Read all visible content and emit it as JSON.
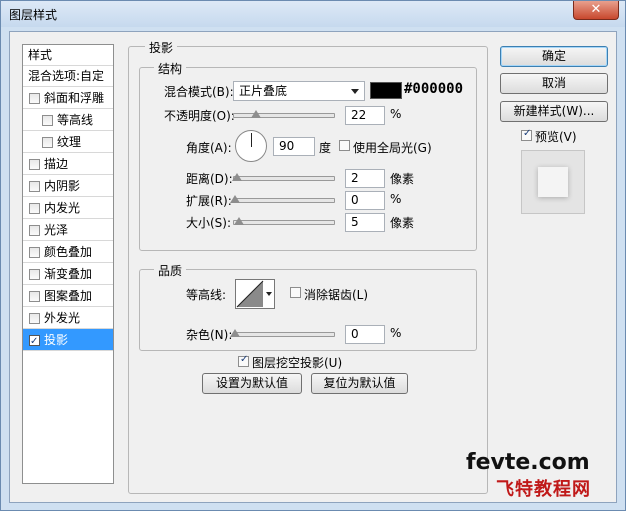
{
  "window": {
    "title": "图层样式",
    "close_glyph": "✕"
  },
  "sidebar": {
    "header": "样式",
    "blend_options": "混合选项:自定",
    "items": [
      {
        "label": "斜面和浮雕",
        "checked": false,
        "indent": false
      },
      {
        "label": "等高线",
        "checked": false,
        "indent": true
      },
      {
        "label": "纹理",
        "checked": false,
        "indent": true
      },
      {
        "label": "描边",
        "checked": false,
        "indent": false
      },
      {
        "label": "内阴影",
        "checked": false,
        "indent": false
      },
      {
        "label": "内发光",
        "checked": false,
        "indent": false
      },
      {
        "label": "光泽",
        "checked": false,
        "indent": false
      },
      {
        "label": "颜色叠加",
        "checked": false,
        "indent": false
      },
      {
        "label": "渐变叠加",
        "checked": false,
        "indent": false
      },
      {
        "label": "图案叠加",
        "checked": false,
        "indent": false
      },
      {
        "label": "外发光",
        "checked": false,
        "indent": false
      },
      {
        "label": "投影",
        "checked": true,
        "indent": false,
        "selected": true
      }
    ]
  },
  "panel": {
    "title": "投影",
    "structure": {
      "title": "结构",
      "blend_mode_label": "混合模式(B):",
      "blend_mode_value": "正片叠底",
      "color_hex": "#000000",
      "color_text": "#000000",
      "opacity_label": "不透明度(O):",
      "opacity_value": "22",
      "opacity_unit": "%",
      "opacity_fraction": 0.22,
      "angle_label": "角度(A):",
      "angle_value": "90",
      "angle_unit": "度",
      "global_light_label": "使用全局光(G)",
      "global_light_checked": false,
      "distance_label": "距离(D):",
      "distance_value": "2",
      "distance_unit": "像素",
      "spread_label": "扩展(R):",
      "spread_value": "0",
      "spread_unit": "%",
      "size_label": "大小(S):",
      "size_value": "5",
      "size_unit": "像素"
    },
    "quality": {
      "title": "品质",
      "contour_label": "等高线:",
      "antialias_label": "消除锯齿(L)",
      "antialias_checked": false,
      "noise_label": "杂色(N):",
      "noise_value": "0",
      "noise_unit": "%"
    },
    "knockout_label": "图层挖空投影(U)",
    "knockout_checked": true,
    "make_default": "设置为默认值",
    "reset_default": "复位为默认值"
  },
  "buttons": {
    "ok": "确定",
    "cancel": "取消",
    "new_style": "新建样式(W)...",
    "preview_label": "预览(V)",
    "preview_checked": true
  },
  "watermark": {
    "line1": "fevte.com",
    "line2": "飞特教程网"
  },
  "check_glyph": "✓"
}
